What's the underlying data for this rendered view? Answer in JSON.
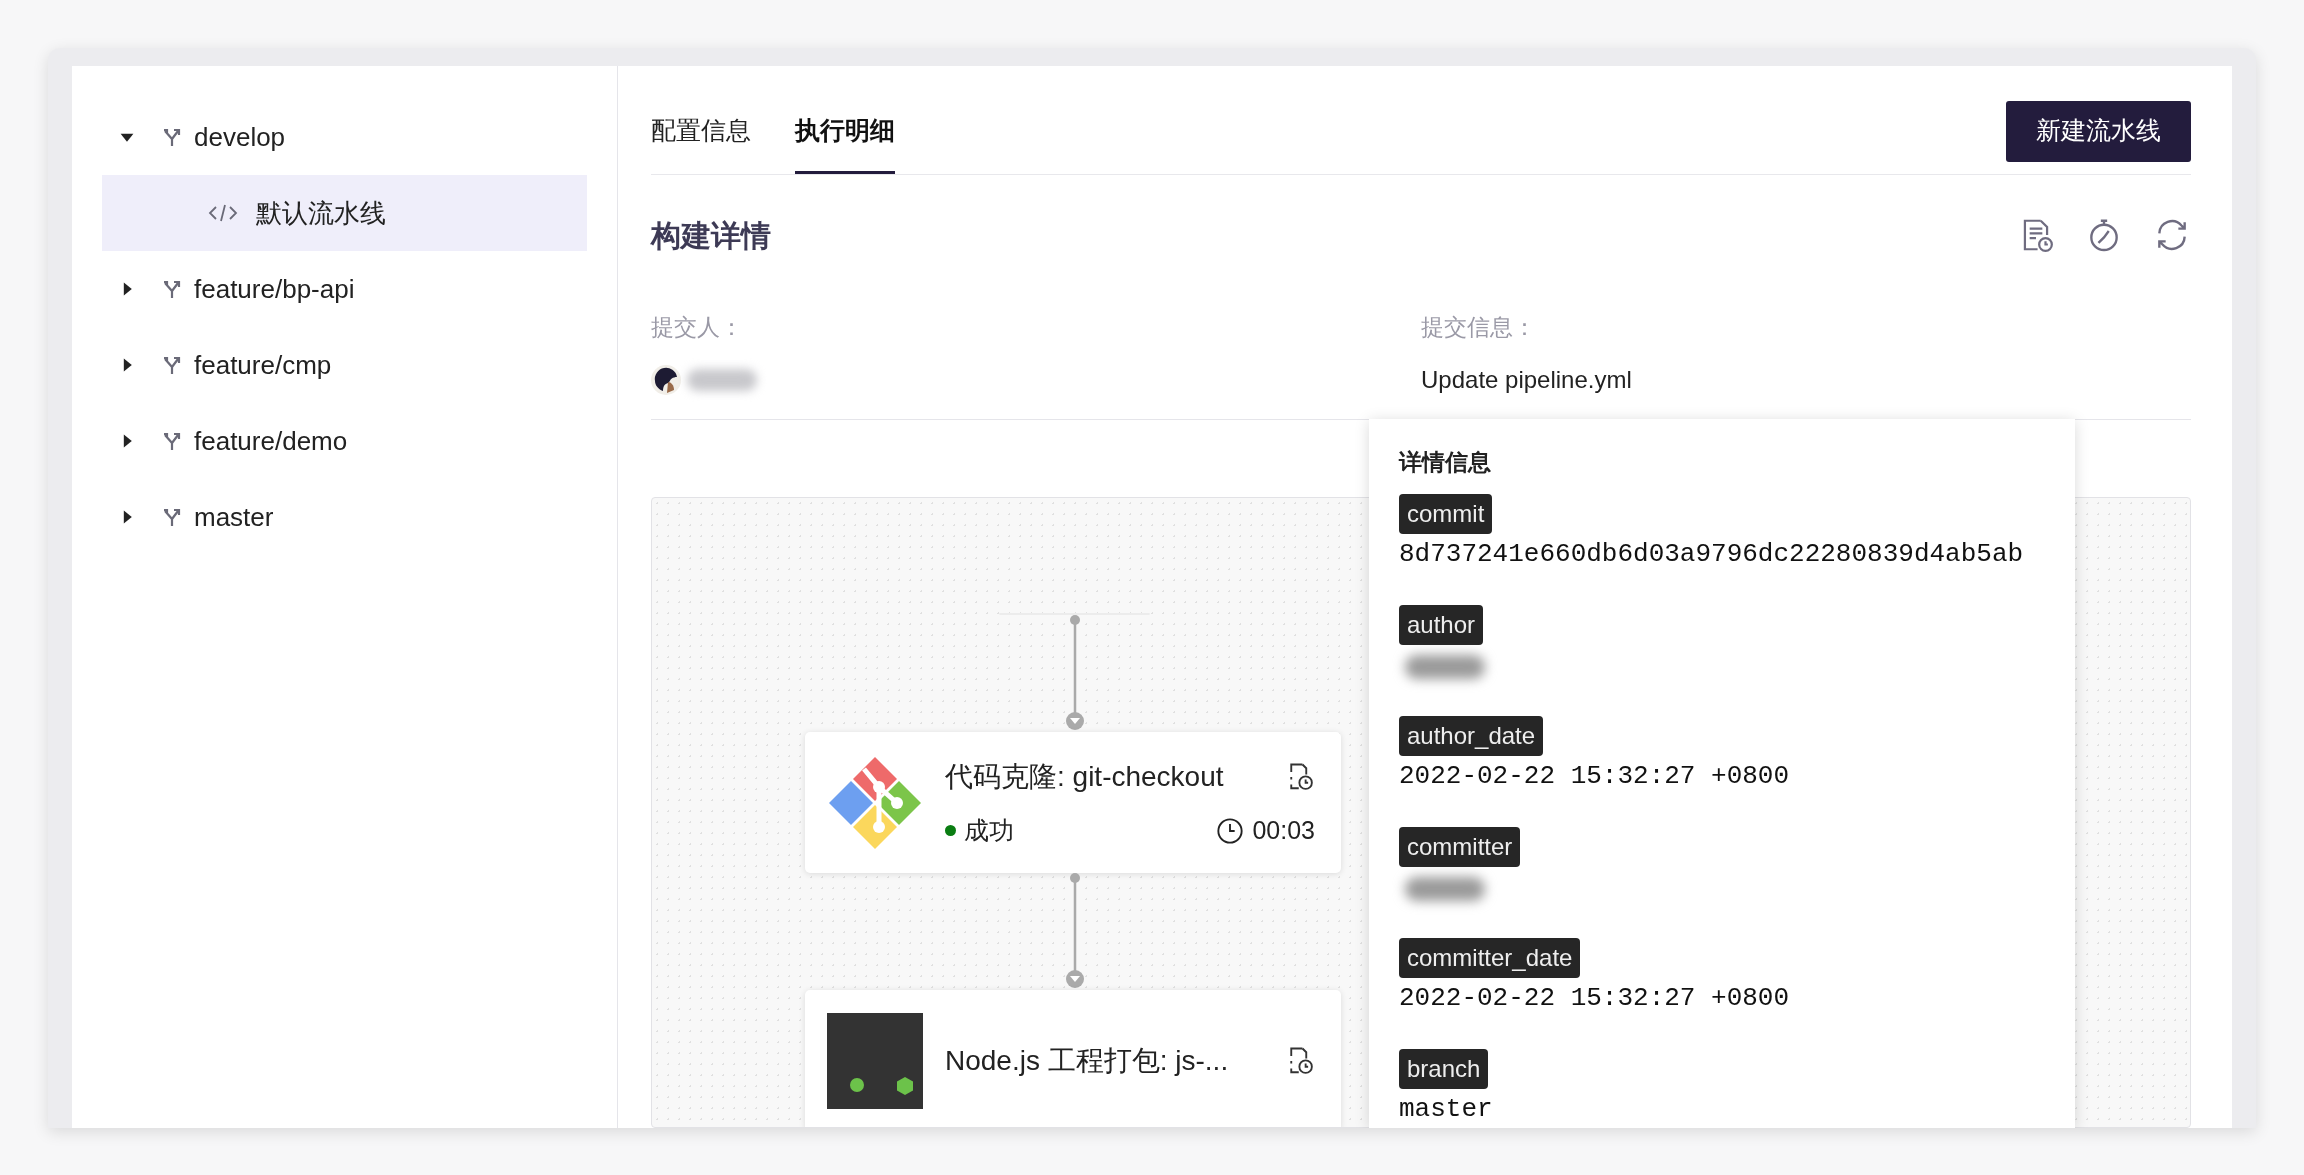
{
  "sidebar": {
    "tree": [
      {
        "label": "develop",
        "expanded": true,
        "selected": false,
        "children": [
          {
            "label": "默认流水线",
            "kind": "pipeline",
            "selected": true
          }
        ]
      },
      {
        "label": "feature/bp-api",
        "expanded": false,
        "selected": false
      },
      {
        "label": "feature/cmp",
        "expanded": false,
        "selected": false
      },
      {
        "label": "feature/demo",
        "expanded": false,
        "selected": false
      },
      {
        "label": "master",
        "expanded": false,
        "selected": false
      }
    ]
  },
  "tabs": [
    {
      "label": "配置信息",
      "selected": false
    },
    {
      "label": "执行明细",
      "selected": true
    }
  ],
  "new_button": "新建流水线",
  "section_title": "构建详情",
  "commit_info": [
    {
      "label": "提交人：",
      "kind": "user"
    },
    {
      "label": "提交信息：",
      "kind": "text",
      "value": "Update pipeline.yml"
    }
  ],
  "pipeline": {
    "steps": [
      {
        "kind": "git",
        "title": "代码克隆: git-checkout",
        "status": "成功",
        "color": "#0a7d12",
        "duration": "00:03"
      },
      {
        "kind": "node",
        "title": "Node.js 工程打包: js-..."
      }
    ]
  },
  "details": {
    "title": "详情信息",
    "fields": [
      {
        "key": "commit",
        "kind": "text",
        "value": "8d737241e660db6d03a9796dc22280839d4ab5ab"
      },
      {
        "key": "author",
        "kind": "redacted"
      },
      {
        "key": "author_date",
        "kind": "text",
        "value": "2022-02-22 15:32:27 +0800"
      },
      {
        "key": "committer",
        "kind": "redacted"
      },
      {
        "key": "committer_date",
        "kind": "text",
        "value": "2022-02-22 15:32:27 +0800"
      },
      {
        "key": "branch",
        "kind": "text",
        "value": "master"
      }
    ]
  }
}
